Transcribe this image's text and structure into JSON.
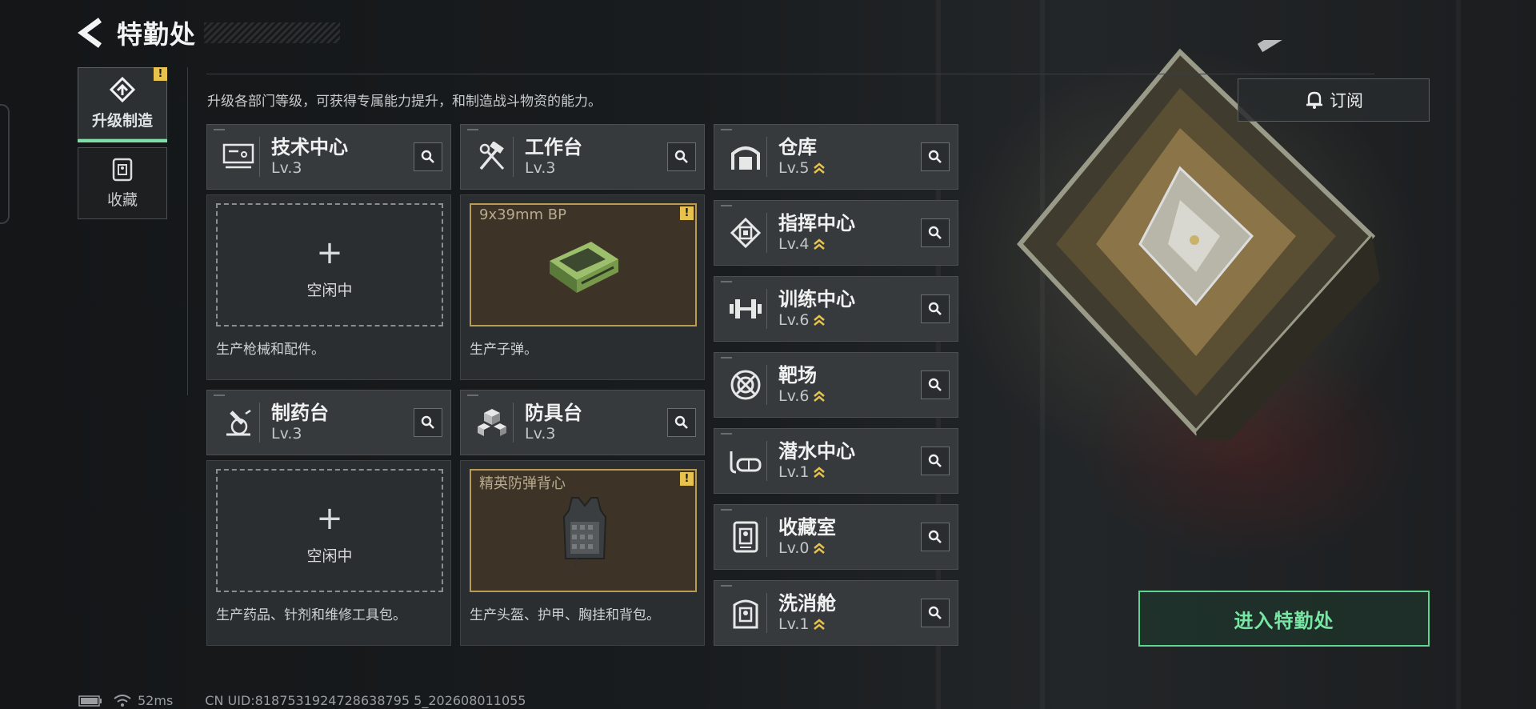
{
  "header": {
    "title": "特勤处"
  },
  "tabs": [
    {
      "label": "升级制造",
      "active": true,
      "icon": "upgrade-icon"
    },
    {
      "label": "收藏",
      "active": false,
      "icon": "collection-icon"
    }
  ],
  "subtitle": "升级各部门等级，可获得专属能力提升，和制造战斗物资的能力。",
  "production": [
    {
      "name": "技术中心",
      "level": "Lv.3",
      "icon": "monitor-icon",
      "status": "idle",
      "plus": "+",
      "idle_label": "空闲中",
      "description": "生产枪械和配件。"
    },
    {
      "name": "工作台",
      "level": "Lv.3",
      "icon": "tools-icon",
      "status": "busy",
      "item": "9x39mm BP",
      "description": "生产子弹。"
    },
    {
      "name": "制药台",
      "level": "Lv.3",
      "icon": "microscope-icon",
      "status": "idle",
      "plus": "+",
      "idle_label": "空闲中",
      "description": "生产药品、针剂和维修工具包。"
    },
    {
      "name": "防具台",
      "level": "Lv.3",
      "icon": "armor-blocks-icon",
      "status": "busy",
      "item": "精英防弹背心",
      "description": "生产头盔、护甲、胸挂和背包。"
    }
  ],
  "facilities": [
    {
      "name": "仓库",
      "level": "Lv.5",
      "icon": "warehouse-icon"
    },
    {
      "name": "指挥中心",
      "level": "Lv.4",
      "icon": "chip-icon"
    },
    {
      "name": "训练中心",
      "level": "Lv.6",
      "icon": "dumbbell-icon"
    },
    {
      "name": "靶场",
      "level": "Lv.6",
      "icon": "target-icon"
    },
    {
      "name": "潜水中心",
      "level": "Lv.1",
      "icon": "diving-mask-icon"
    },
    {
      "name": "收藏室",
      "level": "Lv.0",
      "icon": "collection-room-icon"
    },
    {
      "name": "洗消舱",
      "level": "Lv.1",
      "icon": "decon-icon"
    }
  ],
  "subscribe": {
    "label": "订阅"
  },
  "enter": {
    "label": "进入特勤处"
  },
  "status_bar": {
    "ping": "52ms",
    "uid": "CN UID:8187531924728638795 5_202608011055"
  },
  "colors": {
    "accent": "#7fe0a6",
    "warning": "#e7c24c",
    "busy_border": "#b99c52"
  }
}
